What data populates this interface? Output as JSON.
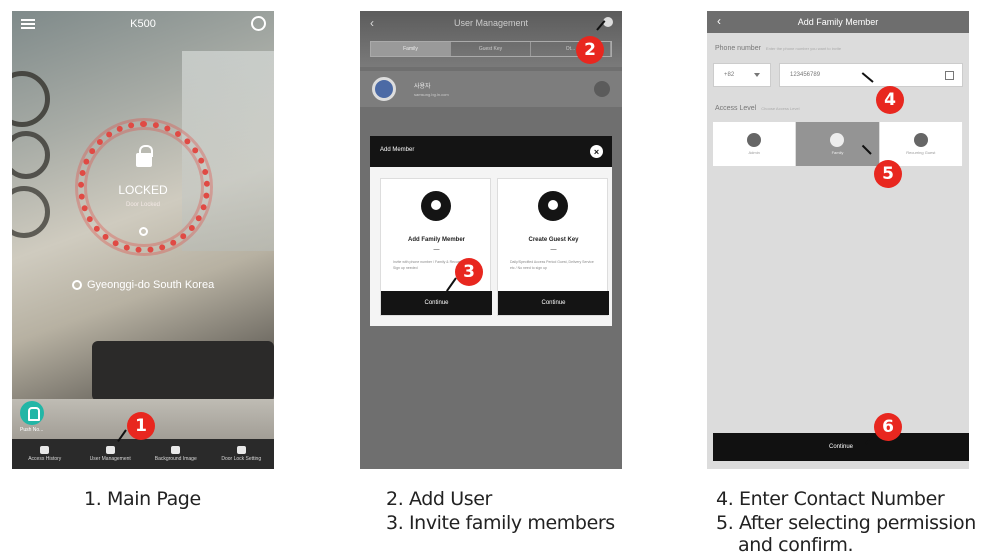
{
  "screen1": {
    "title": "K500",
    "status": "LOCKED",
    "substatus": "Door Locked",
    "location": "Gyeonggi-do  South Korea",
    "bell_label": "Push No...",
    "tabs": [
      "Access History",
      "User Management",
      "Background Image",
      "Door Lock Setting"
    ],
    "caption": "1. Main Page",
    "marker": "1"
  },
  "screen2": {
    "title": "User Management",
    "segments": [
      "Family",
      "Guest Key",
      "Ot..."
    ],
    "member_name": "사용자",
    "member_sub": "samsung.bg.ln.com",
    "modal_title": "Add Member",
    "modal_close": "×",
    "card1": {
      "title": "Add Family Member",
      "dash": "—",
      "text": "Invite with phone number / Family & Recurring Guest / Sign up needed",
      "button": "Continue"
    },
    "card2": {
      "title": "Create Guest Key",
      "dash": "—",
      "text": "Daily/Specified Access Period Guest, Delivery Service etc / No need to sign up",
      "button": "Continue"
    },
    "caption_line1": "2. Add User",
    "caption_line2": "3. Invite family members",
    "marker_a": "2",
    "marker_b": "3"
  },
  "screen3": {
    "title": "Add Family Member",
    "phone_label": "Phone number",
    "phone_hint": "Enter the phone number you want to invite",
    "country_code": "+82",
    "phone_value": "123456789",
    "access_label": "Access Level",
    "access_hint": "Choose Access Level",
    "levels": [
      "Admin",
      "Family",
      "Recurring Guest"
    ],
    "button": "Continue",
    "caption_line1": "4. Enter Contact Number",
    "caption_line2": "5. After selecting permission",
    "caption_line3": "and confirm.",
    "marker_a": "4",
    "marker_b": "5",
    "marker_c": "6"
  },
  "colors": {
    "marker": "#e8271f",
    "lock_ring": "#e04a44",
    "bell": "#22b6a6"
  }
}
